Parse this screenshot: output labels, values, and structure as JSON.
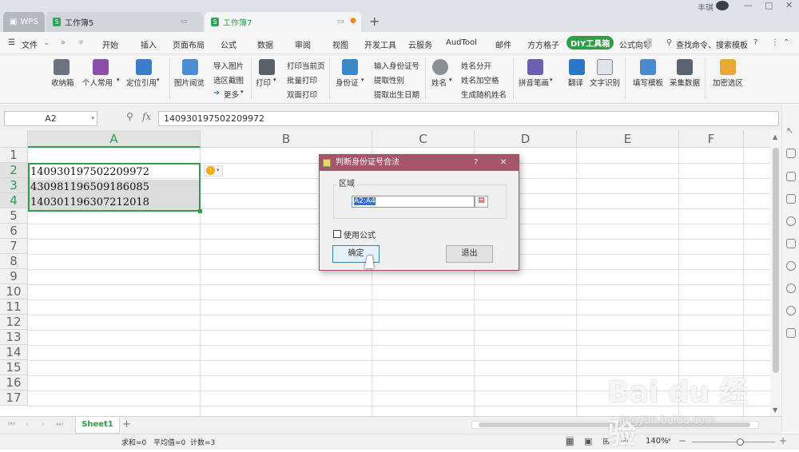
{
  "titlebar": {
    "wps_label": "WPS",
    "tabs": [
      {
        "label": "工作簿5"
      },
      {
        "label": "工作簿7"
      }
    ],
    "new_tab": "+",
    "user": "丰琪",
    "controls": [
      "—",
      "□",
      "✕"
    ]
  },
  "menu": {
    "file": "文件",
    "items": [
      "开始",
      "插入",
      "页面布局",
      "公式",
      "数据",
      "审阅",
      "视图",
      "开发工具",
      "云服务",
      "AudTool",
      "邮件",
      "方方格子",
      "DIY工具箱",
      "公式向导"
    ],
    "search": "查找命令、搜索模板",
    "help": "?"
  },
  "ribbon": {
    "collect": "收纳箱",
    "personal": "个人常用",
    "locate": "定位引用",
    "img_view": "图片阅览",
    "import_img": "导入图片",
    "select_shot": "选区截图",
    "more": "更多",
    "print": "打印",
    "print_current": "打印当前页",
    "batch_print": "批量打印",
    "duplex_print": "双面打印",
    "idcard": "身份证",
    "input_id": "输入身份证号",
    "get_gender": "提取性别",
    "get_birth": "提取出生日期",
    "name": "姓名",
    "split_name": "姓名分开",
    "name_space": "姓名加空格",
    "random_name": "生成随机姓名",
    "pinyin": "拼音笔画",
    "translate": "翻译",
    "ocr": "文字识别",
    "fill_template": "填写模板",
    "collect_data": "采集数据",
    "encrypt": "加密选区"
  },
  "formula": {
    "cell_ref": "A2",
    "fx": "fx",
    "value": "140930197502209972"
  },
  "columns": [
    "A",
    "B",
    "C",
    "D",
    "E",
    "F"
  ],
  "rows": [
    "1",
    "2",
    "3",
    "4",
    "5",
    "6",
    "7",
    "8",
    "9",
    "10",
    "11",
    "12",
    "13",
    "14",
    "15",
    "16",
    "17"
  ],
  "cells": [
    "140930197502209972",
    "430981196509186085",
    "140301196307212018"
  ],
  "dialog": {
    "title": "判断身份证号合法",
    "help": "?",
    "close": "✕",
    "group_label": "区域",
    "range_value": "A2:A4",
    "use_formula": "使用公式",
    "ok": "确定",
    "exit": "退出"
  },
  "sheets": {
    "active": "Sheet1",
    "add": "+"
  },
  "status": {
    "sum": "求和=0",
    "avg": "平均值=0",
    "count": "计数=3",
    "zoom": "140%"
  },
  "watermark": {
    "text": "Bai du 经验",
    "url": "jingyan.baidu.com"
  },
  "colors": {
    "accent_green": "#2e9e48",
    "dialog_title": "#a5566b"
  }
}
